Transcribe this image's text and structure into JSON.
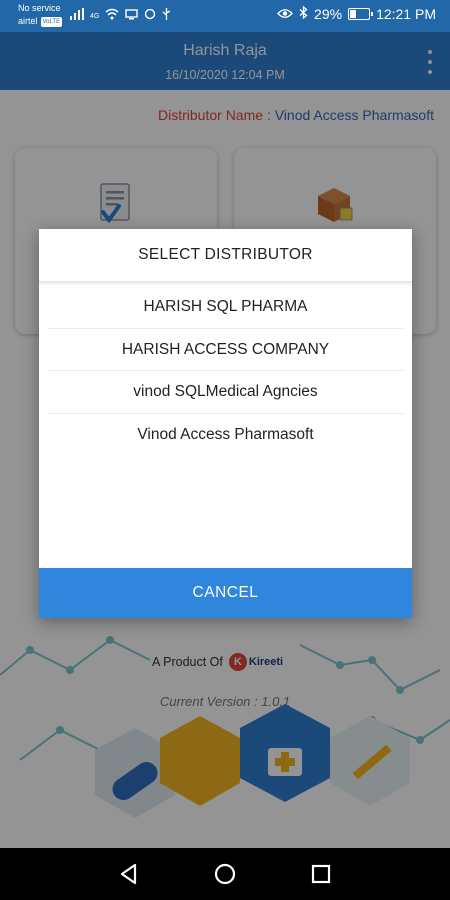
{
  "status_bar": {
    "carrier_line1": "No service",
    "carrier_line2": "airtel",
    "volte": "VoLTE",
    "network_type": "4G",
    "battery": "29%",
    "time": "12:21 PM"
  },
  "header": {
    "user_name": "Harish Raja",
    "date_time": "16/10/2020 12:04 PM"
  },
  "distributor": {
    "label": "Distributor Name : ",
    "value": "Vinod Access Pharmasoft"
  },
  "footer": {
    "product_of": "A Product Of",
    "logo_text": "Kireeti",
    "version": "Current Version : 1.0.1"
  },
  "dialog": {
    "title": "SELECT DISTRIBUTOR",
    "options": [
      "HARISH SQL PHARMA",
      "HARISH ACCESS COMPANY",
      "vinod SQLMedical Agncies",
      "Vinod Access Pharmasoft"
    ],
    "cancel_label": "CANCEL"
  },
  "colors": {
    "status_bar": "#2267a8",
    "header": "#2f7ed2",
    "cancel_button": "#2f86dc",
    "distributor_label": "#e0463b",
    "distributor_value": "#2d6cc0"
  },
  "icons": {
    "nav": [
      "back-icon",
      "home-icon",
      "recent-apps-icon"
    ],
    "tiles": [
      "document-check-icon",
      "box-icon"
    ]
  }
}
